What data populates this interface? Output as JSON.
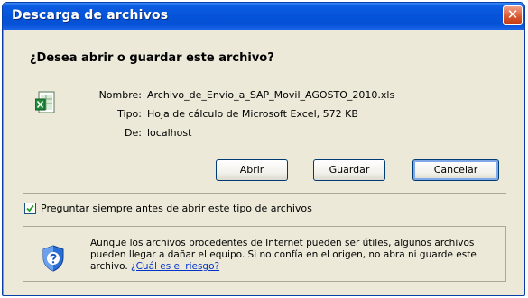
{
  "window": {
    "title": "Descarga de archivos",
    "close_glyph": "✕"
  },
  "dialog": {
    "question": "¿Desea abrir o guardar este archivo?",
    "file": {
      "icon": "excel-file-icon",
      "name_label": "Nombre:",
      "name_value": "Archivo_de_Envio_a_SAP_Movil_AGOSTO_2010.xls",
      "type_label": "Tipo:",
      "type_value": "Hoja de cálculo de Microsoft Excel, 572 KB",
      "from_label": "De:",
      "from_value": "localhost"
    },
    "buttons": {
      "open_label": "Abrir",
      "save_label": "Guardar",
      "cancel_label": "Cancelar"
    },
    "checkbox": {
      "label": "Preguntar siempre antes de abrir este tipo de archivos",
      "checked": true
    },
    "warning": {
      "icon": "security-shield-icon",
      "text": "Aunque los archivos procedentes de Internet pueden ser útiles, algunos archivos pueden llegar a dañar el equipo. Si no confía en el origen, no abra ni guarde este archivo.",
      "link_label": "¿Cuál es el riesgo?"
    }
  },
  "colors": {
    "titlebar": "#0553d8",
    "dialog_bg": "#ece9d8",
    "link": "#0033cc",
    "close_button": "#d8552c"
  }
}
